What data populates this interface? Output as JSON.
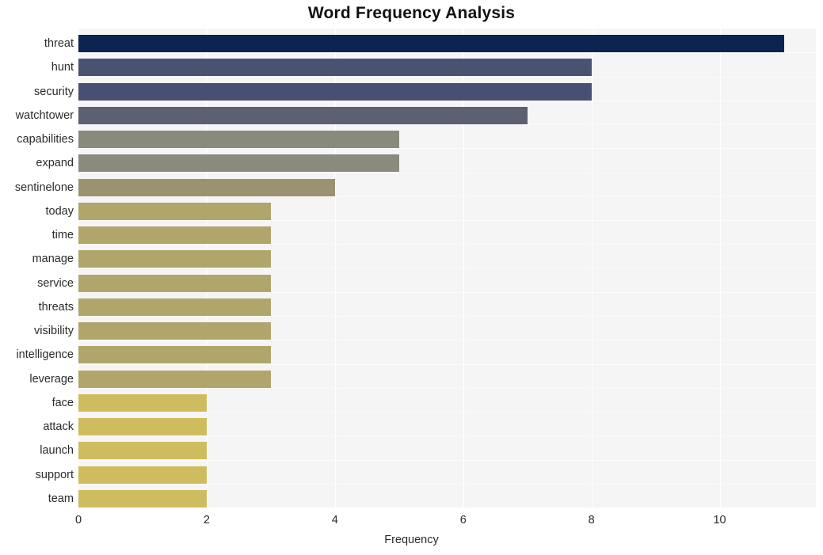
{
  "chart_data": {
    "type": "bar",
    "orientation": "horizontal",
    "title": "Word Frequency Analysis",
    "xlabel": "Frequency",
    "ylabel": "",
    "categories": [
      "threat",
      "hunt",
      "security",
      "watchtower",
      "capabilities",
      "expand",
      "sentinelone",
      "today",
      "time",
      "manage",
      "service",
      "threats",
      "visibility",
      "intelligence",
      "leverage",
      "face",
      "attack",
      "launch",
      "support",
      "team"
    ],
    "values": [
      11,
      8,
      8,
      7,
      5,
      5,
      4,
      3,
      3,
      3,
      3,
      3,
      3,
      3,
      3,
      2,
      2,
      2,
      2,
      2
    ],
    "bar_colors": [
      "#0a2350",
      "#495271",
      "#485071",
      "#5c6070",
      "#888a7c",
      "#8a8b7e",
      "#9b9272",
      "#b0a66c",
      "#b0a66c",
      "#b0a66c",
      "#b0a66c",
      "#b0a66c",
      "#b0a66c",
      "#b0a66c",
      "#b0a66c",
      "#cfbc5f",
      "#cfbc5f",
      "#cfbc5f",
      "#cfbc5f",
      "#cfbc5f"
    ],
    "xticks": [
      0,
      2,
      4,
      6,
      8,
      10
    ],
    "xtick_labels": [
      "0",
      "2",
      "4",
      "6",
      "8",
      "10"
    ],
    "xlim": [
      0,
      11.5
    ],
    "grid": true,
    "grid_axis": "both",
    "legend": "none",
    "plot_background": "#f5f5f6",
    "figure_background": "#ffffff",
    "gridline_color": "#ffffff"
  }
}
